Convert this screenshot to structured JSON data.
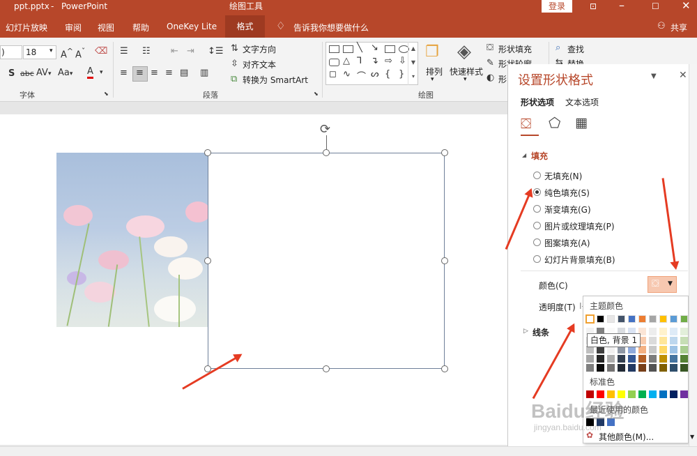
{
  "title": {
    "file": "ppt.pptx",
    "dash": "-",
    "app": "PowerPoint",
    "drawing_tools": "绘图工具",
    "login": "登录",
    "share": "共享"
  },
  "tabs": [
    "幻灯片放映",
    "审阅",
    "视图",
    "帮助",
    "OneKey Lite",
    "格式"
  ],
  "tellme": "告诉我你想要做什么",
  "ribbon": {
    "font_size": "18",
    "font_name_tail": ")",
    "text_direction": "文字方向",
    "align_text": "对齐文本",
    "convert_smartart": "转换为 SmartArt",
    "arrange": "排列",
    "quick_styles": "快速样式",
    "shape_fill": "形状填充",
    "shape_outline": "形状轮廓",
    "shape_effects": "形",
    "find": "查找",
    "replace": "替换",
    "group_font": "字体",
    "group_paragraph": "段落",
    "group_drawing": "绘图"
  },
  "panel": {
    "title": "设置形状格式",
    "tab_shape": "形状选项",
    "tab_text": "文本选项",
    "fill_header": "填充",
    "options": [
      "无填充(N)",
      "纯色填充(S)",
      "渐变填充(G)",
      "图片或纹理填充(P)",
      "图案填充(A)",
      "幻灯片背景填充(B)"
    ],
    "selected_option": "纯色填充(S)",
    "color_label": "颜色(C)",
    "transparency_label": "透明度(T)",
    "transparency_tail": "I-",
    "line_header": "线条"
  },
  "palette": {
    "theme_colors": "主题颜色",
    "tooltip": "白色, 背景 1",
    "standard": "标准色",
    "recent": "最近使用的颜色",
    "more": "其他颜色(M)...",
    "theme_row": [
      "#ffffff",
      "#000000",
      "#e7e6e6",
      "#44546a",
      "#4472c4",
      "#ed7d31",
      "#a5a5a5",
      "#ffc000",
      "#5b9bd5",
      "#70ad47"
    ],
    "standard_row": [
      "#c00000",
      "#ff0000",
      "#ffc000",
      "#ffff00",
      "#92d050",
      "#00b050",
      "#00b0f0",
      "#0070c0",
      "#002060",
      "#7030a0"
    ],
    "recent_row": [
      "#000000",
      "#1f3864",
      "#4472c4"
    ]
  },
  "watermark": {
    "brand": "Baidu经验",
    "url": "jingyan.baidu.com"
  },
  "colors": {
    "accent": "#b7472a",
    "arrow": "#e53b22",
    "selected_border": "#f0a27a"
  }
}
